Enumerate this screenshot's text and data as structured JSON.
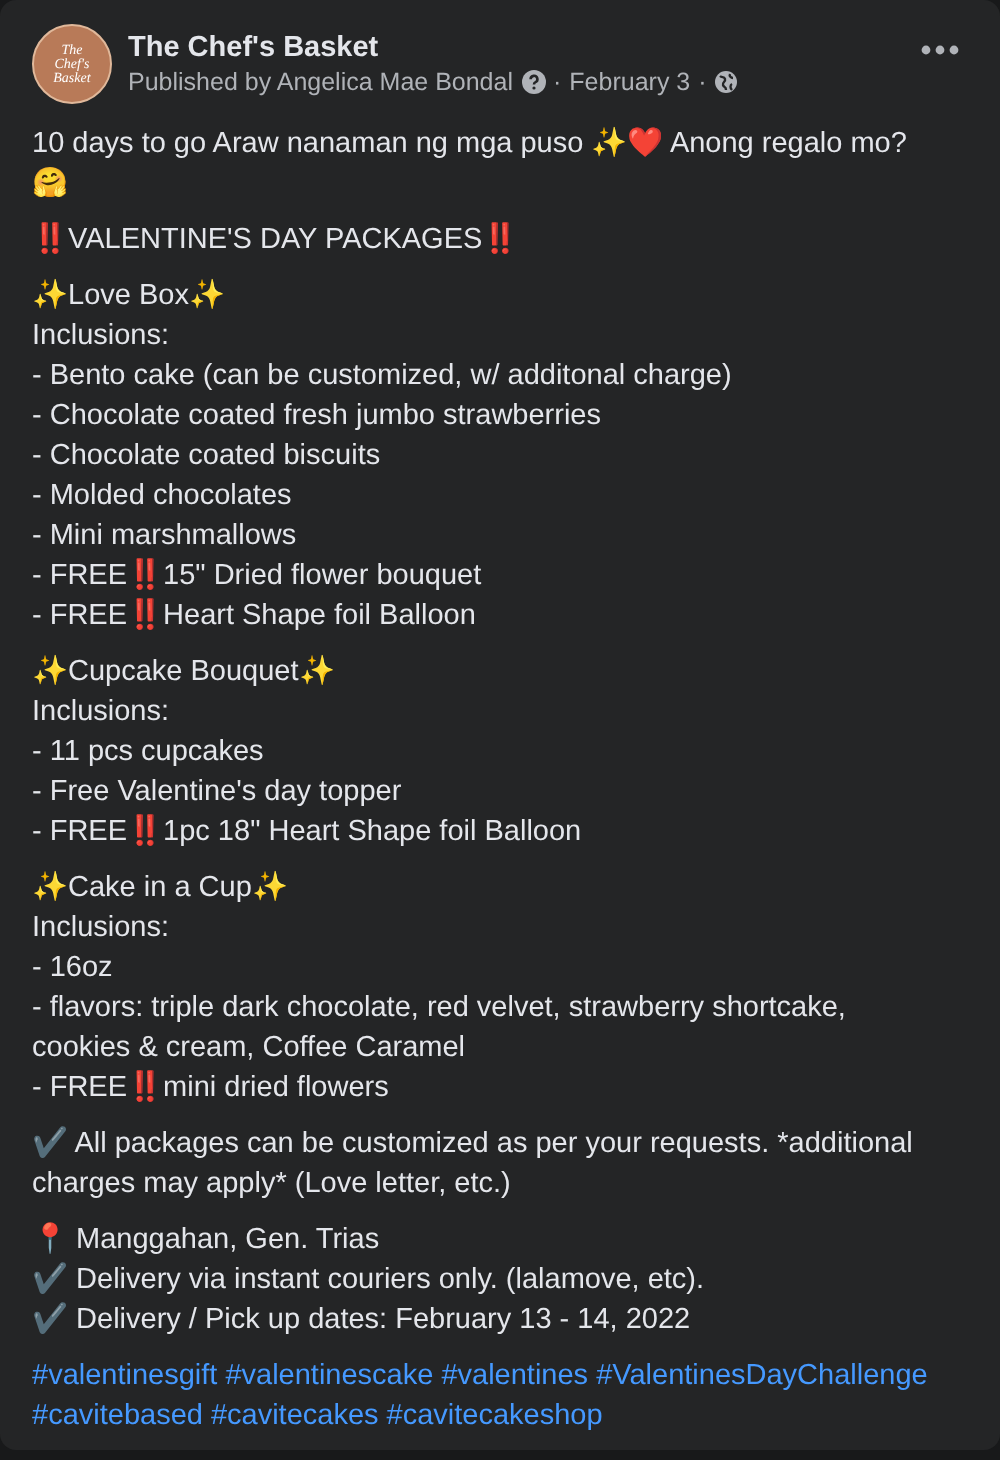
{
  "post": {
    "page_name": "The Chef's Basket",
    "logo_text": "The Chef's Basket",
    "publisher": "Published by Angelica Mae Bondal",
    "date": "February 3",
    "separators": [
      "·",
      "·"
    ],
    "paragraphs": [
      [
        "10 days to go Araw nanaman ng mga puso ✨❤️ Anong regalo mo? 🤗"
      ],
      [
        "‼️VALENTINE'S DAY PACKAGES‼️"
      ],
      [
        "✨Love Box✨",
        "Inclusions:",
        "- Bento cake (can be customized, w/ additonal charge)",
        "- Chocolate coated fresh jumbo strawberries",
        "- Chocolate coated biscuits",
        "- Molded chocolates",
        "- Mini marshmallows",
        "- FREE‼️15\" Dried flower bouquet",
        "- FREE‼️Heart Shape foil Balloon"
      ],
      [
        "✨Cupcake Bouquet✨",
        "Inclusions:",
        "- 11 pcs cupcakes",
        "- Free Valentine's day topper",
        "- FREE‼️1pc 18\" Heart Shape foil Balloon"
      ],
      [
        "✨Cake in a Cup✨",
        "Inclusions:",
        "- 16oz",
        "- flavors: triple dark chocolate, red velvet, strawberry shortcake, cookies & cream, Coffee Caramel",
        "- FREE‼️mini dried flowers"
      ],
      [
        "✔️ All packages can be customized as per your requests. *additional charges may apply* (Love letter, etc.)"
      ],
      [
        "📍 Manggahan, Gen. Trias",
        "✔️ Delivery via instant couriers only. (lalamove, etc).",
        "✔️ Delivery / Pick up dates: February 13 - 14, 2022"
      ]
    ],
    "hashtags": [
      "#valentinesgift",
      "#valentinescake",
      "#valentines",
      "#ValentinesDayChallenge",
      "#cavitebased",
      "#cavitecakes",
      "#cavitecakeshop"
    ]
  }
}
